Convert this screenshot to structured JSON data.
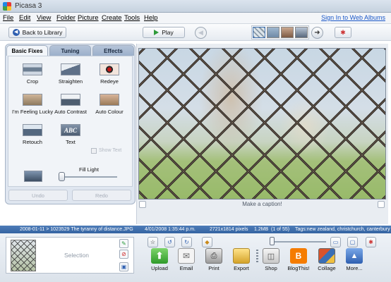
{
  "window": {
    "title": "Picasa 3"
  },
  "menu": {
    "items": [
      "File",
      "Edit",
      "View",
      "Folder",
      "Picture",
      "Create",
      "Tools",
      "Help"
    ],
    "sign_in": "Sign In to Web Albums"
  },
  "toolbar": {
    "back_label": "Back to Library",
    "play_label": "Play"
  },
  "edit_panel": {
    "tabs": [
      "Basic Fixes",
      "Tuning",
      "Effects"
    ],
    "active_tab": "Basic Fixes",
    "fixes": [
      "Crop",
      "Straighten",
      "Redeye",
      "I'm Feeling Lucky",
      "Auto Contrast",
      "Auto Colour",
      "Retouch",
      "Text"
    ],
    "show_text_label": "Show Text",
    "fill_light_label": "Fill Light",
    "fill_light_value": 0,
    "undo_label": "Undo",
    "redo_label": "Redo"
  },
  "photo": {
    "caption_placeholder": "Make a caption!"
  },
  "status": {
    "path": "2008-01-11 > 1023529 The tyranny of distance.JPG",
    "date": "4/01/2008 1:35:44 p.m.",
    "dimensions": "2721x1814 pixels",
    "size": "1.2MB",
    "position": "(1 of 55)",
    "tags": "Tags:new zealand, christchurch, canterbury"
  },
  "tray": {
    "selection_label": "Selection"
  },
  "actions": [
    "Upload",
    "Email",
    "Print",
    "Export",
    "Shop",
    "BlogThis!",
    "Collage",
    "More..."
  ],
  "colors": {
    "status_bar": "#3d6ca9",
    "link": "#1a57c8",
    "panel_bg": "#dfe6f0"
  }
}
